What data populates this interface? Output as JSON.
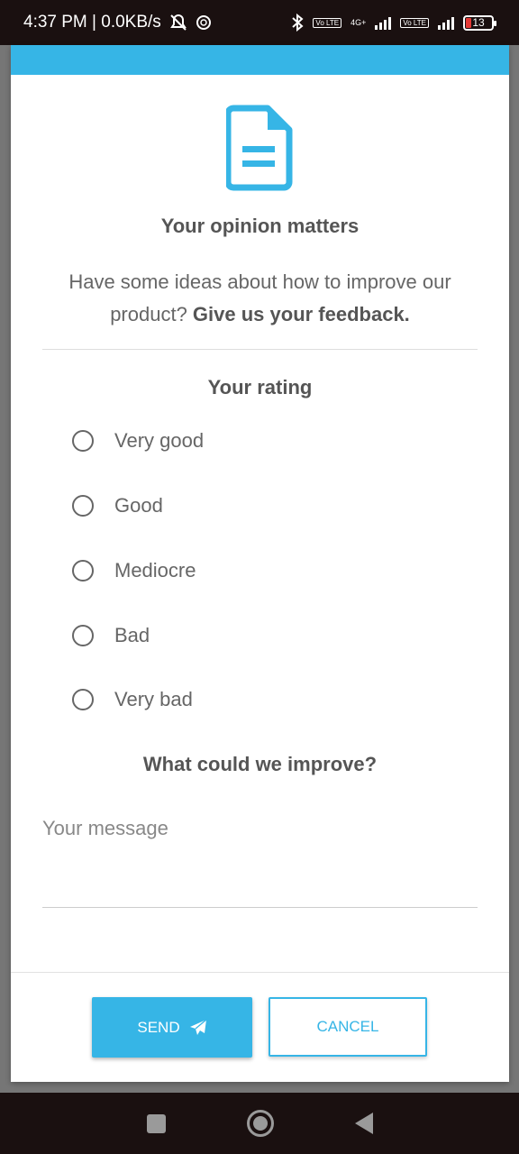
{
  "status_bar": {
    "time_speed": "4:37 PM | 0.0KB/s",
    "network_label": "4G+",
    "volte_label": "Vo LTE",
    "battery_level": "13",
    "icons": [
      "mute-icon",
      "vpn-icon",
      "bluetooth-icon",
      "signal-icon",
      "battery-icon"
    ]
  },
  "dialog": {
    "accent_color": "#36b5e6",
    "header_icon": "document-icon",
    "title": "Your opinion matters",
    "subtitle_plain": "Have some ideas about how to improve our product? ",
    "subtitle_bold": "Give us your feedback.",
    "rating_title": "Your rating",
    "rating_options": [
      "Very good",
      "Good",
      "Mediocre",
      "Bad",
      "Very bad"
    ],
    "improve_title": "What could we improve?",
    "message_placeholder": "Your message",
    "send_label": "SEND",
    "send_icon": "paper-plane-icon",
    "cancel_label": "CANCEL"
  },
  "nav_bar": {
    "icons": [
      "recents-icon",
      "home-icon",
      "back-icon"
    ]
  }
}
